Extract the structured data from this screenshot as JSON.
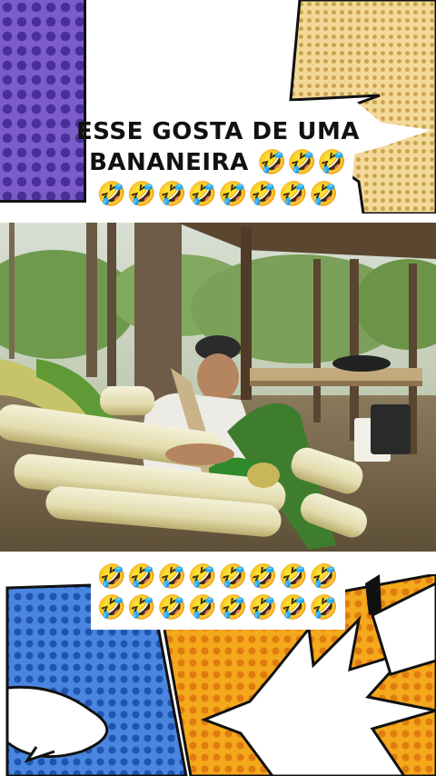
{
  "caption": {
    "line1": "ESSE GOSTA DE UMA",
    "line2": "BANANEIRA 🤣🤣🤣",
    "line3": "🤣🤣🤣🤣🤣🤣🤣🤣"
  },
  "bottom_emojis": {
    "row1": "🤣🤣🤣🤣🤣🤣🤣🤣",
    "row2": "🤣🤣🤣🤣🤣🤣🤣🤣"
  },
  "colors": {
    "purple": "#7b5cc8",
    "gold": "#f2d99a",
    "blue": "#4a86e0",
    "orange": "#f4a81c"
  }
}
